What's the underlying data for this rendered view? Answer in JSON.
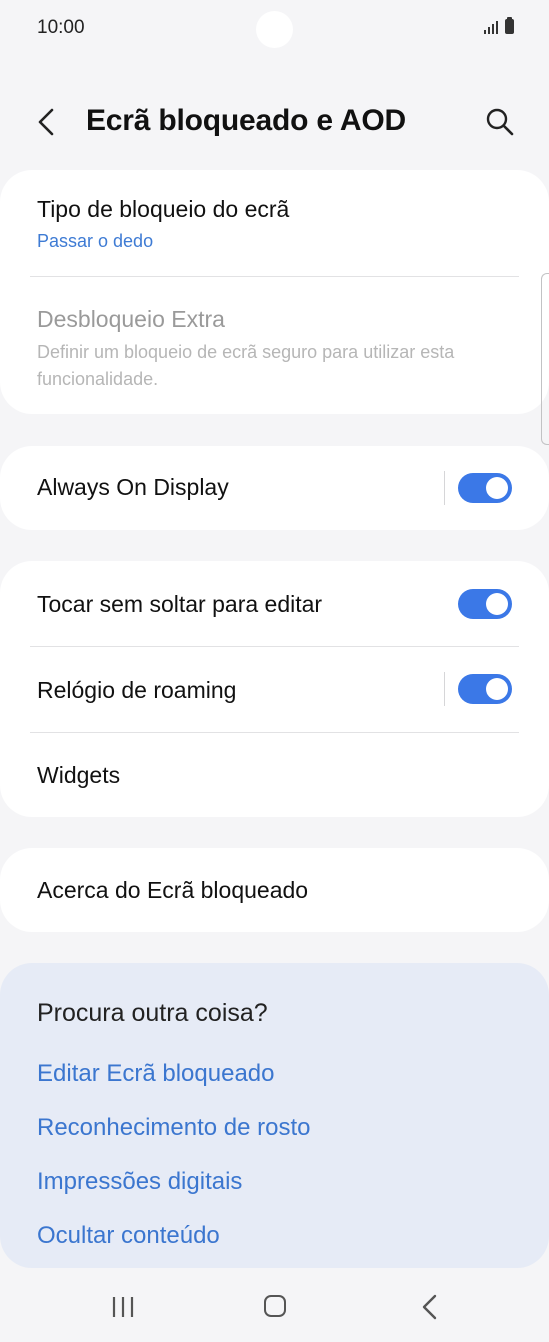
{
  "status_bar": {
    "time": "10:00"
  },
  "header": {
    "title": "Ecrã bloqueado e AOD"
  },
  "lock_section": {
    "screen_lock_type": {
      "title": "Tipo de bloqueio do ecrã",
      "value": "Passar o dedo"
    },
    "extra_unlock": {
      "title": "Desbloqueio Extra",
      "description": "Definir um bloqueio de ecrã seguro para utilizar esta funcionalidade.",
      "enabled": false
    }
  },
  "aod_section": {
    "always_on_display": {
      "title": "Always On Display",
      "on": true
    }
  },
  "options_section": {
    "touch_hold_edit": {
      "title": "Tocar sem soltar para editar",
      "on": true
    },
    "roaming_clock": {
      "title": "Relógio de roaming",
      "on": true
    },
    "widgets": {
      "title": "Widgets"
    }
  },
  "about_section": {
    "title": "Acerca do Ecrã bloqueado"
  },
  "suggestions": {
    "title": "Procura outra coisa?",
    "links": [
      "Editar Ecrã bloqueado",
      "Reconhecimento de rosto",
      "Impressões digitais",
      "Ocultar conteúdo"
    ]
  },
  "colors": {
    "accent": "#3b78e7",
    "link": "#3b76cf",
    "background": "#f5f5f7",
    "suggest_bg": "#e6ebf6"
  }
}
